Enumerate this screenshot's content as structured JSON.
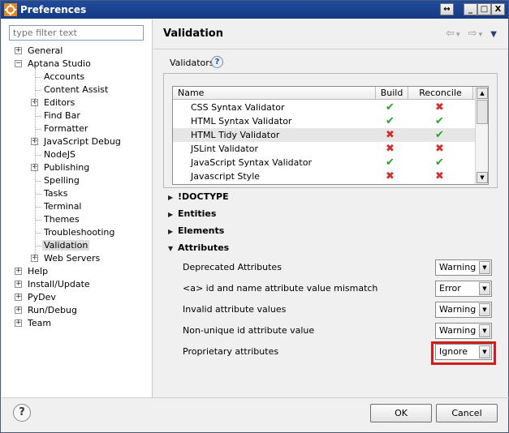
{
  "window": {
    "title": "Preferences"
  },
  "titlebar_buttons": [
    "↔",
    "_",
    "□",
    "X"
  ],
  "filter": {
    "placeholder": "type filter text"
  },
  "tree": [
    {
      "label": "General",
      "level": 0,
      "toggle": "+"
    },
    {
      "label": "Aptana Studio",
      "level": 0,
      "toggle": "−"
    },
    {
      "label": "Accounts",
      "level": 1,
      "toggle": ""
    },
    {
      "label": "Content Assist",
      "level": 1,
      "toggle": ""
    },
    {
      "label": "Editors",
      "level": 1,
      "toggle": "+"
    },
    {
      "label": "Find Bar",
      "level": 1,
      "toggle": ""
    },
    {
      "label": "Formatter",
      "level": 1,
      "toggle": ""
    },
    {
      "label": "JavaScript Debug",
      "level": 1,
      "toggle": "+"
    },
    {
      "label": "NodeJS",
      "level": 1,
      "toggle": ""
    },
    {
      "label": "Publishing",
      "level": 1,
      "toggle": "+"
    },
    {
      "label": "Spelling",
      "level": 1,
      "toggle": ""
    },
    {
      "label": "Tasks",
      "level": 1,
      "toggle": ""
    },
    {
      "label": "Terminal",
      "level": 1,
      "toggle": ""
    },
    {
      "label": "Themes",
      "level": 1,
      "toggle": ""
    },
    {
      "label": "Troubleshooting",
      "level": 1,
      "toggle": ""
    },
    {
      "label": "Validation",
      "level": 1,
      "toggle": "",
      "selected": true
    },
    {
      "label": "Web Servers",
      "level": 1,
      "toggle": "+"
    },
    {
      "label": "Help",
      "level": 0,
      "toggle": "+"
    },
    {
      "label": "Install/Update",
      "level": 0,
      "toggle": "+"
    },
    {
      "label": "PyDev",
      "level": 0,
      "toggle": "+"
    },
    {
      "label": "Run/Debug",
      "level": 0,
      "toggle": "+"
    },
    {
      "label": "Team",
      "level": 0,
      "toggle": "+"
    }
  ],
  "page": {
    "title": "Validation",
    "nav_icons": [
      "⇦",
      "▾",
      "⇨",
      "▾",
      "▼"
    ],
    "validators_label": "Validators",
    "help_glyph": "?"
  },
  "validators_table": {
    "columns": [
      "Name",
      "Build",
      "Reconcile"
    ],
    "rows": [
      {
        "name": "CSS Syntax Validator",
        "build": true,
        "reconcile": false
      },
      {
        "name": "HTML Syntax Validator",
        "build": true,
        "reconcile": true
      },
      {
        "name": "HTML Tidy Validator",
        "build": false,
        "reconcile": true,
        "selected": true
      },
      {
        "name": "JSLint Validator",
        "build": false,
        "reconcile": false
      },
      {
        "name": "JavaScript Syntax Validator",
        "build": true,
        "reconcile": true
      },
      {
        "name": "Javascript Style",
        "build": false,
        "reconcile": false
      }
    ]
  },
  "sections": [
    {
      "label": "!DOCTYPE",
      "expanded": false
    },
    {
      "label": "Entities",
      "expanded": false
    },
    {
      "label": "Elements",
      "expanded": false
    },
    {
      "label": "Attributes",
      "expanded": true
    }
  ],
  "attributes": [
    {
      "label": "Deprecated Attributes",
      "value": "Warning"
    },
    {
      "label": "<a> id and name attribute value mismatch",
      "value": "Error"
    },
    {
      "label": "Invalid attribute values",
      "value": "Warning"
    },
    {
      "label": "Non-unique id attribute value",
      "value": "Warning"
    },
    {
      "label": "Proprietary attributes",
      "value": "Ignore",
      "highlighted": true
    }
  ],
  "buttons": {
    "ok": "OK",
    "cancel": "Cancel",
    "help": "?"
  },
  "colors": {
    "titlebar": "#1f4a9c",
    "check": "#2aa12a",
    "cross": "#d62c2c",
    "highlight": "#d01e1e"
  }
}
